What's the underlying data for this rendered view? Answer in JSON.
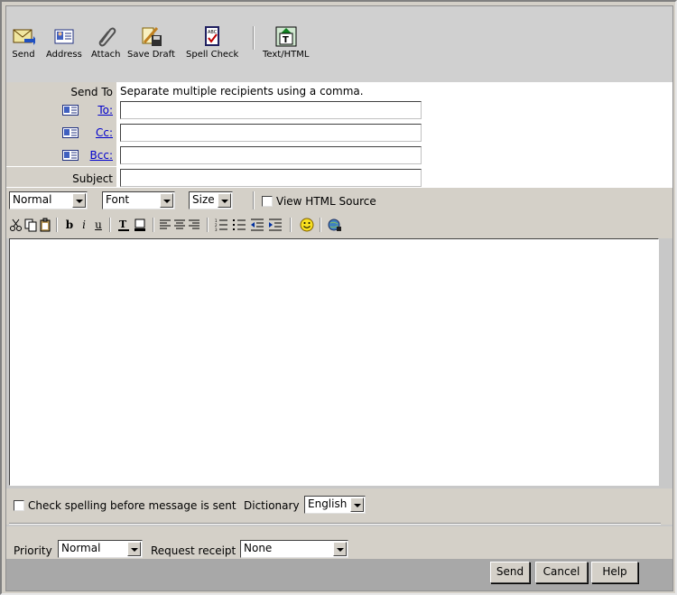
{
  "toolbar": {
    "send": "Send",
    "address": "Address",
    "attach": "Attach",
    "save_draft": "Save Draft",
    "spell_check": "Spell Check",
    "text_html": "Text/HTML"
  },
  "recipients": {
    "send_to_label": "Send To",
    "hint": "Separate multiple recipients using a comma.",
    "to_label": "To:",
    "cc_label": "Cc:",
    "bcc_label": "Bcc:",
    "to_value": "",
    "cc_value": "",
    "bcc_value": "",
    "subject_label": "Subject",
    "subject_value": ""
  },
  "format": {
    "paragraph": "Normal",
    "font": "Font",
    "size": "Size",
    "view_html_source": "View HTML Source"
  },
  "editor": {
    "cut": "cut-icon",
    "copy": "copy-icon",
    "paste": "paste-icon",
    "bold": "b",
    "italic": "i",
    "underline": "u",
    "text_color": "text-color-icon",
    "bg_color": "background-color-icon",
    "align_left": "align-left-icon",
    "align_center": "align-center-icon",
    "align_right": "align-right-icon",
    "ordered_list": "ordered-list-icon",
    "unordered_list": "unordered-list-icon",
    "outdent": "outdent-icon",
    "indent": "indent-icon",
    "smiley": "smiley-icon",
    "hyperlink": "hyperlink-icon",
    "body": ""
  },
  "options": {
    "check_spelling": "Check spelling before message is sent",
    "dictionary_label": "Dictionary",
    "dictionary_value": "English",
    "priority_label": "Priority",
    "priority_value": "Normal",
    "receipt_label": "Request receipt",
    "receipt_value": "None"
  },
  "buttons": {
    "send": "Send",
    "cancel": "Cancel",
    "help": "Help"
  }
}
